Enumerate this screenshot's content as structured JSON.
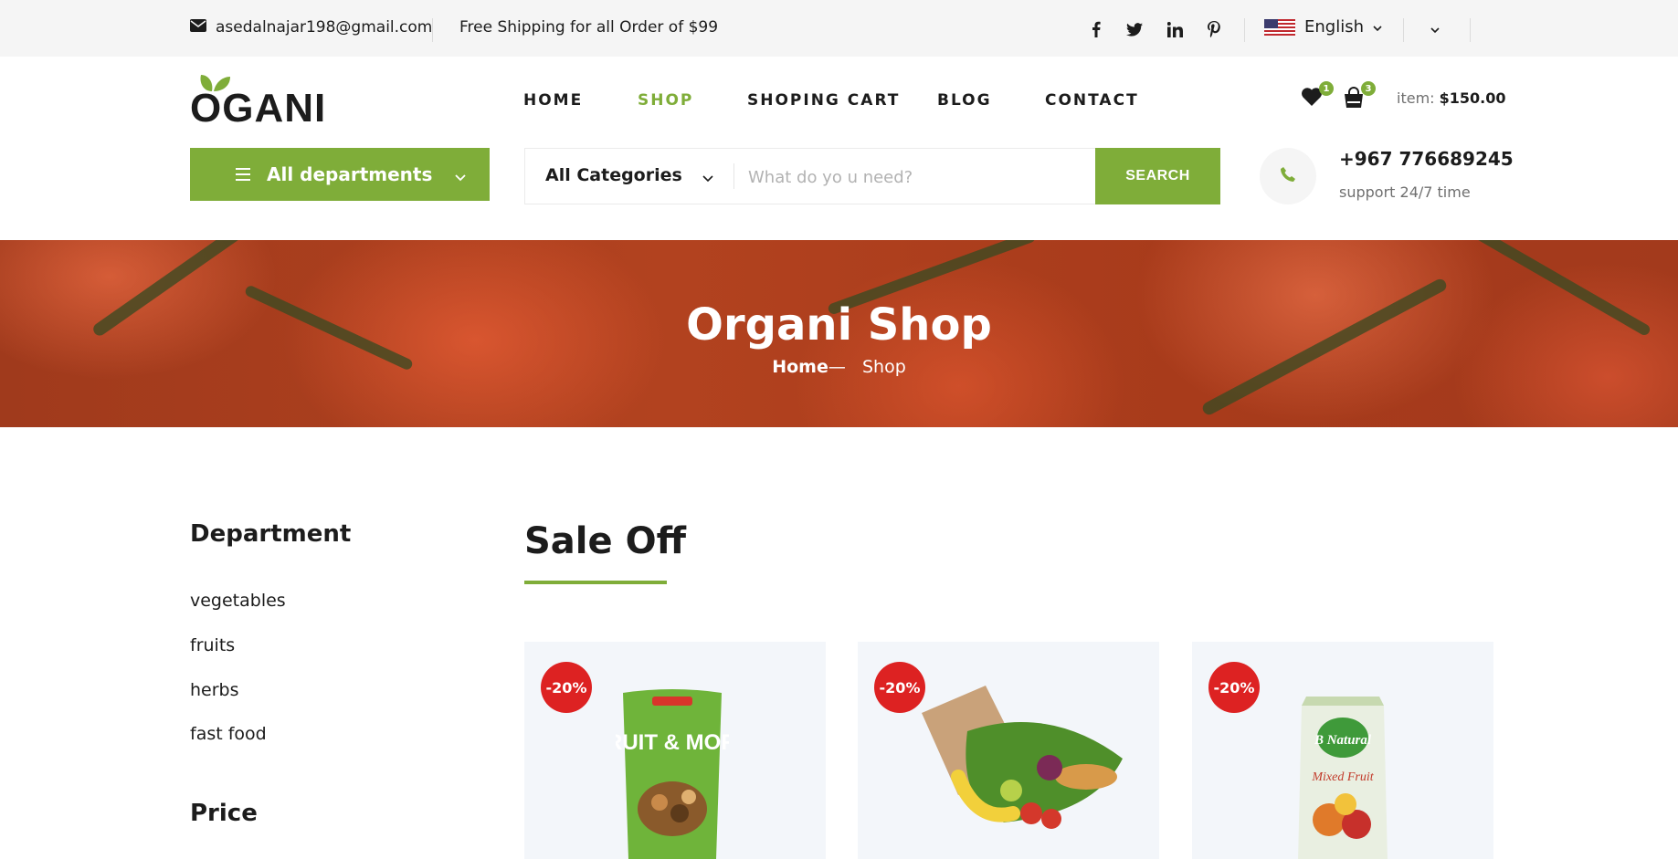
{
  "topbar": {
    "email": "asedalnajar198@gmail.com",
    "shipping": "Free Shipping for all Order of $99",
    "social": [
      "facebook-icon",
      "twitter-icon",
      "linkedin-icon",
      "pinterest-icon"
    ],
    "language": "English"
  },
  "header": {
    "logo": "OGANI",
    "nav": [
      {
        "label": "HOME",
        "active": false
      },
      {
        "label": "SHOP",
        "active": true
      },
      {
        "label": "SHOPING CART",
        "active": false
      },
      {
        "label": "BLOG",
        "active": false
      },
      {
        "label": "CONTACT",
        "active": false
      }
    ],
    "wishlist_count": "1",
    "cart_count": "3",
    "cart_label": "item:",
    "cart_total": "$150.00"
  },
  "departments": {
    "label": "All departments"
  },
  "search": {
    "category": "All Categories",
    "placeholder": "What do yo u need?",
    "button": "SEARCH"
  },
  "contact": {
    "phone": "+967 776689245",
    "support": "support 24/7 time"
  },
  "hero": {
    "title": "Organi Shop",
    "crumb_home": "Home",
    "crumb_sep": "—",
    "crumb_current": "Shop"
  },
  "sidebar": {
    "department_title": "Department",
    "departments": [
      "vegetables",
      "fruits",
      "herbs",
      "fast food"
    ],
    "price_title": "Price"
  },
  "sale": {
    "title": "Sale Off",
    "cards": [
      {
        "discount": "-20%",
        "product": "FRUIT & MORE"
      },
      {
        "discount": "-20%",
        "product": ""
      },
      {
        "discount": "-20%",
        "product": "B Natural"
      }
    ]
  },
  "colors": {
    "accent": "#7fad39",
    "discount": "#dd2222",
    "topbar_bg": "#f5f5f5"
  }
}
